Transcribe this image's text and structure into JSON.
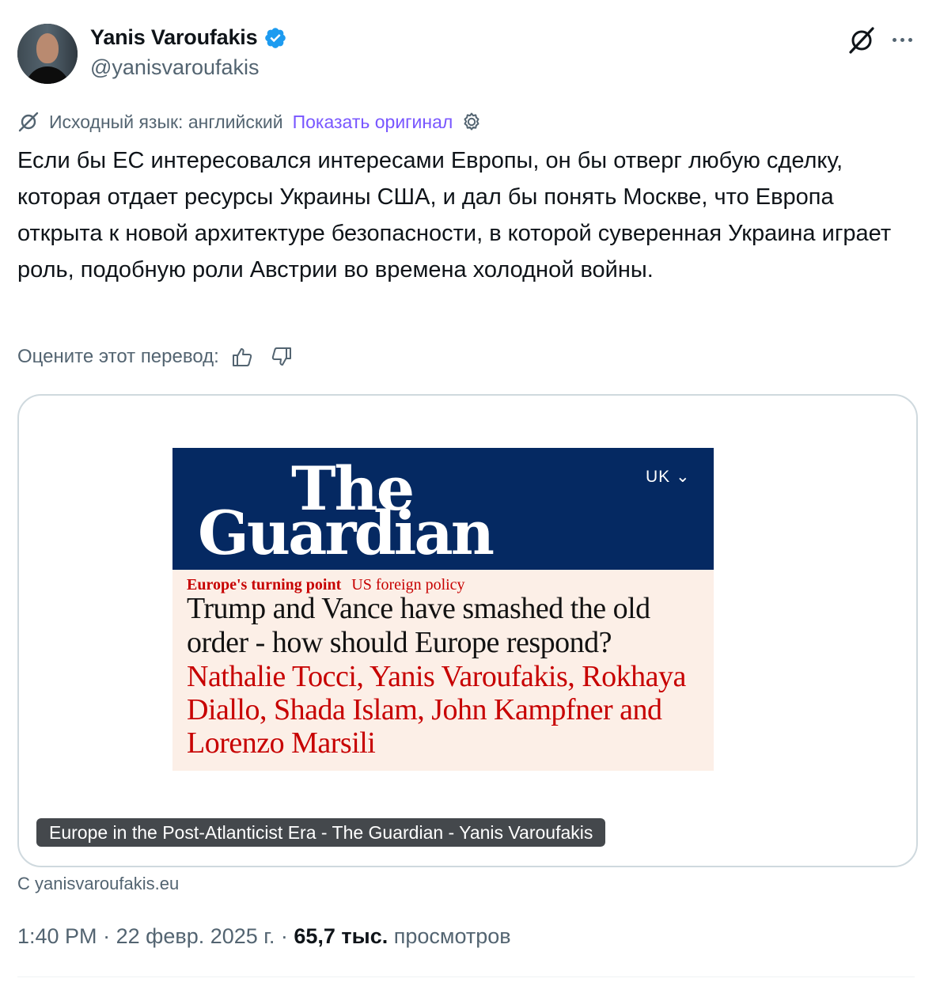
{
  "author": {
    "display_name": "Yanis Varoufakis",
    "handle": "@yanisvaroufakis",
    "verified": true,
    "verified_color": "#1d9bf0"
  },
  "translation": {
    "source_language_label": "Исходный язык: английский",
    "show_original_label": "Показать оригинал",
    "rate_prompt": "Оцените этот перевод:"
  },
  "tweet": {
    "text": "Если бы ЕС интересовался интересами Европы, он бы отверг любую сделку, которая отдает ресурсы Украины США, и дал бы понять Москве, что Европа открыта к новой архитектуре безопасности, в которой суверенная Украина играет роль, подобную роли Австрии во времена холодной войны."
  },
  "card": {
    "image": {
      "masthead_line1": "The",
      "masthead_line2": "Guardian",
      "edition": "UK ⌄",
      "kicker_primary": "Europe's turning point",
      "kicker_secondary": "US foreign policy",
      "headline": "Trump and Vance have smashed the old order - how should Europe respond?",
      "byline": "Nathalie Tocci, Yanis Varoufakis, Rokhaya Diallo, Shada Islam, John Kampfner and Lorenzo Marsili",
      "masthead_color": "#052962",
      "background_color": "#fcefe7",
      "accent_color": "#c70000"
    },
    "caption": "Europe in the Post-Atlanticist Era - The Guardian - Yanis Varoufakis",
    "source": "С yanisvaroufakis.eu"
  },
  "meta": {
    "time": "1:40 PM",
    "separator": "·",
    "date": "22 февр. 2025 г.",
    "views_count": "65,7 тыс.",
    "views_label": "просмотров"
  },
  "icons": {
    "grok": "grok-icon",
    "more": "more-icon",
    "translate": "grok-translate-icon",
    "settings": "gear-icon",
    "thumbs_up": "thumbs-up-icon",
    "thumbs_down": "thumbs-down-icon",
    "verified": "verified-badge-icon"
  }
}
